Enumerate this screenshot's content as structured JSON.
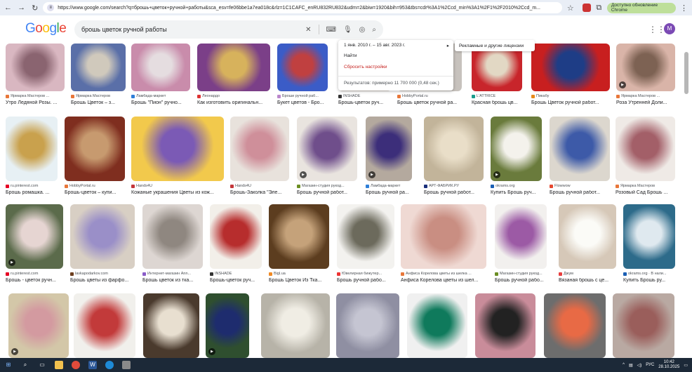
{
  "browser": {
    "url": "https://www.google.com/search?q=брошь+цветок+ручной+работы&sca_esv=fe06bbe1a7ea018c&rlz=1C1CAFC_enRU832RU832&udm=2&biw=1920&bih=953&tbs=cdr%3A1%2Ccd_min%3A1%2F1%2F2010%2Ccd_m...",
    "update_label": "Доступно обновление Chrome",
    "icons": {
      "back": "back-arrow-icon",
      "forward": "forward-arrow-icon",
      "reload": "reload-icon",
      "star": "star-icon"
    }
  },
  "google": {
    "logo": "Google",
    "query": "брошь цветок ручной работы",
    "avatar_letter": "M"
  },
  "date_popup": {
    "range": "1 янв. 2010 г. – 15 авг. 2023 г.",
    "find": "Найти",
    "reset": "Сбросить настройки",
    "results": "Результатов: примерно 11 700 000 (0,48 сек.)"
  },
  "license_chip": "Рекламные и другие лицензии",
  "rows": [
    [
      {
        "src": "Ярмарка Мастеров ...",
        "title": "Утро Ледяной Розы. ...",
        "srcColor": "#e8773a",
        "c1": "#d9b7c1",
        "c2": "#8a6470",
        "play": false
      },
      {
        "src": "Ярмарка Мастеров",
        "title": "Брошь Цветок – з...",
        "srcColor": "#e8773a",
        "c1": "#5a6fa8",
        "c2": "#d0c9bc",
        "play": false
      },
      {
        "src": "Ламбада-маркет",
        "title": "Брошь \"Пион\" ручно...",
        "srcColor": "#2f7fd8",
        "c1": "#c98cab",
        "c2": "#e5dde0",
        "play": false
      },
      {
        "src": "Леонардо",
        "title": "Как изготовить оригинальн...",
        "srcColor": "#d33",
        "c1": "#7b3f88",
        "c2": "#d7b25c",
        "play": false
      },
      {
        "src": "Броши ручной раб...",
        "title": "Букет цветов - Бро...",
        "srcColor": "#b8c",
        "c1": "#3b5cc7",
        "c2": "#c04040",
        "play": false
      },
      {
        "src": "INSHADE",
        "title": "Брошь-цветок руч...",
        "srcColor": "#333",
        "c1": "#d7cfc8",
        "c2": "#9a8f88",
        "play": false
      },
      {
        "src": "HobbyPortal.ru",
        "title": "Брошь цветок ручной ра...",
        "srcColor": "#e8773a",
        "c1": "#c7c2bd",
        "c2": "#9e9993",
        "play": false
      },
      {
        "src": "L'ATTRICE",
        "title": "Красная брошь цв...",
        "srcColor": "#1a9c8c",
        "c1": "#c8252b",
        "c2": "#e2d8c4",
        "play": false
      },
      {
        "src": "Пикабу",
        "title": "Брошь Цветок ручной работ...",
        "srcColor": "#e88b1a",
        "c1": "#c81f1f",
        "c2": "#1e3d86",
        "play": false
      },
      {
        "src": "Ярмарка Мастеров ...",
        "title": "Роза Утренней Доли...",
        "srcColor": "#e8773a",
        "c1": "#d9b4a8",
        "c2": "#7d6253",
        "play": true
      }
    ],
    [
      {
        "src": "ru.pinterest.com",
        "title": "Брошь ромашка. ...",
        "srcColor": "#e60023",
        "c1": "#e7f0f4",
        "c2": "#c9a14d",
        "play": false
      },
      {
        "src": "HobbyPortal.ru",
        "title": "Брошь-цветок – купи...",
        "srcColor": "#e8773a",
        "c1": "#7f2e1f",
        "c2": "#c79a6f",
        "play": false
      },
      {
        "src": "Hands4U",
        "title": "Кожаные украшения Цветы из кож...",
        "srcColor": "#c4373a",
        "c1": "#f2c94c",
        "c2": "#7b5ab5",
        "play": false
      },
      {
        "src": "Hands4U",
        "title": "Брошь-Заколка \"Эле...",
        "srcColor": "#c4373a",
        "c1": "#e8e2dc",
        "c2": "#cf8f9a",
        "play": false
      },
      {
        "src": "Магазин-студия рукод...",
        "title": "Брошь ручной работ...",
        "srcColor": "#6b8e23",
        "c1": "#e9e4df",
        "c2": "#6f4e8b",
        "play": true
      },
      {
        "src": "Ламбада-маркет",
        "title": "Брошь ручной ра...",
        "srcColor": "#2f7fd8",
        "c1": "#b4a99e",
        "c2": "#3c2e7a",
        "play": true
      },
      {
        "src": "АРТ-ФАБРИК.РУ",
        "title": "Брошь ручной работ...",
        "srcColor": "#1a2f7b",
        "c1": "#c2b49a",
        "c2": "#e9dec8",
        "play": false
      },
      {
        "src": "okrams.org",
        "title": "Купить Брошь руч...",
        "srcColor": "#1a5fb4",
        "c1": "#6a7b3c",
        "c2": "#f4f2ec",
        "play": true
      },
      {
        "src": "Flowwow",
        "title": "Брошь ручной работ...",
        "srcColor": "#e6482f",
        "c1": "#dcd7ce",
        "c2": "#3d5aa8",
        "play": false
      },
      {
        "src": "Ярмарка Мастеров",
        "title": "Розовый Сад Брошь ...",
        "srcColor": "#e8773a",
        "c1": "#efeae6",
        "c2": "#a35f68",
        "play": false
      }
    ],
    [
      {
        "src": "ru.pinterest.com",
        "title": "Брошь - цветок ручн...",
        "srcColor": "#e60023",
        "c1": "#5b6b4b",
        "c2": "#e6d5d2",
        "play": true
      },
      {
        "src": "lavkapodarkov.com",
        "title": "Брошь цветы из фарфо...",
        "srcColor": "#6d3f1f",
        "c1": "#d8cfc4",
        "c2": "#9a8fc8",
        "play": false
      },
      {
        "src": "Интернет-магазин Ann...",
        "title": "Брошь цветок из тка...",
        "srcColor": "#8a5cc8",
        "c1": "#ddd6d2",
        "c2": "#8f8780",
        "play": false
      },
      {
        "src": "INSHADE",
        "title": "Брошь-цветок руч...",
        "srcColor": "#333",
        "c1": "#f2efe9",
        "c2": "#b72d2d",
        "play": false
      },
      {
        "src": "Bigl.ua",
        "title": "Брошь Цветок Из Тка...",
        "srcColor": "#f08a24",
        "c1": "#5c3d1f",
        "c2": "#c5a27a",
        "play": false
      },
      {
        "src": "Ювелирная бижутер...",
        "title": "Брошь ручной рабо...",
        "srcColor": "#e33",
        "c1": "#f3f2ef",
        "c2": "#6c6a5c",
        "play": false
      },
      {
        "src": "Анфиса Корелова цветы из шелка ...",
        "title": "Анфиса Корелова цветы из шел...",
        "srcColor": "#e8773a",
        "c1": "#efd9d3",
        "c2": "#c98e82",
        "play": false
      },
      {
        "src": "Магазин-студия рукод...",
        "title": "Брошь ручной рабо...",
        "srcColor": "#6b8e23",
        "c1": "#f2f0ee",
        "c2": "#9c5aa5",
        "play": false
      },
      {
        "src": "Джум",
        "title": "Вязаная брошь с це...",
        "srcColor": "#e83e3e",
        "c1": "#d6c8b8",
        "c2": "#fbfbf7",
        "play": false
      },
      {
        "src": "okrams.org · В нали...",
        "title": "Купить Брошь ру...",
        "srcColor": "#1a5fb4",
        "c1": "#2d6b8a",
        "c2": "#dfe9ef",
        "play": false
      }
    ],
    [
      {
        "src": "",
        "title": "",
        "srcColor": "#fff",
        "c1": "#d3c7a8",
        "c2": "#d39aa0",
        "play": true
      },
      {
        "src": "",
        "title": "",
        "srcColor": "#fff",
        "c1": "#f1f0ec",
        "c2": "#c23a3a",
        "play": false
      },
      {
        "src": "",
        "title": "",
        "srcColor": "#fff",
        "c1": "#4a3a2d",
        "c2": "#e8dfd0",
        "play": false
      },
      {
        "src": "",
        "title": "",
        "srcColor": "#fff",
        "c1": "#2f4f2f",
        "c2": "#1e2c6e",
        "play": true
      },
      {
        "src": "",
        "title": "",
        "srcColor": "#fff",
        "c1": "#b7b3a8",
        "c2": "#f0ede4",
        "play": false
      },
      {
        "src": "",
        "title": "",
        "srcColor": "#fff",
        "c1": "#8f8fa2",
        "c2": "#c5c5d2",
        "play": false
      },
      {
        "src": "",
        "title": "",
        "srcColor": "#fff",
        "c1": "#f0f0f0",
        "c2": "#0f7a5c",
        "play": false
      },
      {
        "src": "",
        "title": "",
        "srcColor": "#fff",
        "c1": "#c98c9a",
        "c2": "#222",
        "play": false
      },
      {
        "src": "",
        "title": "",
        "srcColor": "#fff",
        "c1": "#6d6d6d",
        "c2": "#e86a45",
        "play": false
      },
      {
        "src": "",
        "title": "",
        "srcColor": "#fff",
        "c1": "#b9a9a2",
        "c2": "#9a5e5b",
        "play": false
      }
    ]
  ],
  "taskbar": {
    "lang": "РУС",
    "time": "10:42",
    "date": "28.10.2025"
  }
}
